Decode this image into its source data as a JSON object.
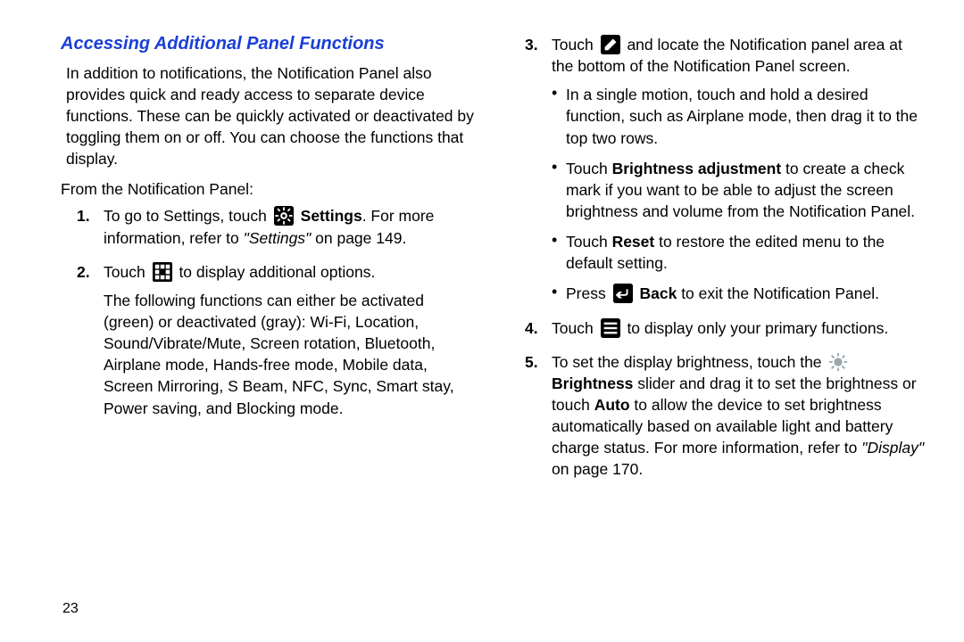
{
  "pageNumber": "23",
  "title": "Accessing Additional Panel Functions",
  "intro": "In addition to notifications, the Notification Panel also provides quick and ready access to separate device functions. These can be quickly activated or deactivated by toggling them on or off. You can choose the functions that display.",
  "lead": "From the Notification Panel:",
  "step1": {
    "a": "To go to Settings, touch ",
    "settings": "Settings",
    "b": ". For more information, refer to ",
    "ref": "\"Settings\"",
    "c": " on page 149."
  },
  "step2": {
    "a": "Touch ",
    "b": " to display additional options.",
    "follow": "The following functions can either be activated (green) or deactivated (gray): Wi-Fi, Location, Sound/Vibrate/Mute, Screen rotation, Bluetooth, Airplane mode, Hands-free mode, Mobile data, Screen Mirroring, S Beam, NFC, Sync, Smart stay, Power saving, and Blocking mode."
  },
  "step3": {
    "a": "Touch ",
    "b": " and locate the Notification panel area at the bottom of the Notification Panel screen.",
    "bullets": {
      "b1": "In a single motion, touch and hold a desired function, such as Airplane mode, then drag it to the top two rows.",
      "b2a": "Touch ",
      "b2bold": "Brightness adjustment",
      "b2b": " to create a check mark if you want to be able to adjust the screen brightness and volume from the Notification Panel.",
      "b3a": "Touch ",
      "b3bold": "Reset",
      "b3b": " to restore the edited menu to the default setting.",
      "b4a": "Press ",
      "b4bold": "Back",
      "b4b": " to exit the Notification Panel."
    }
  },
  "step4": {
    "a": "Touch ",
    "b": " to display only your primary functions."
  },
  "step5": {
    "a": "To set the display brightness, touch the ",
    "bold1": "Brightness",
    "b": " slider and drag it to set the brightness or touch ",
    "bold2": "Auto",
    "c": " to allow the device to set brightness automatically based on available light and battery charge status. For more information, refer to ",
    "ref": "\"Display\"",
    "d": " on page 170."
  }
}
